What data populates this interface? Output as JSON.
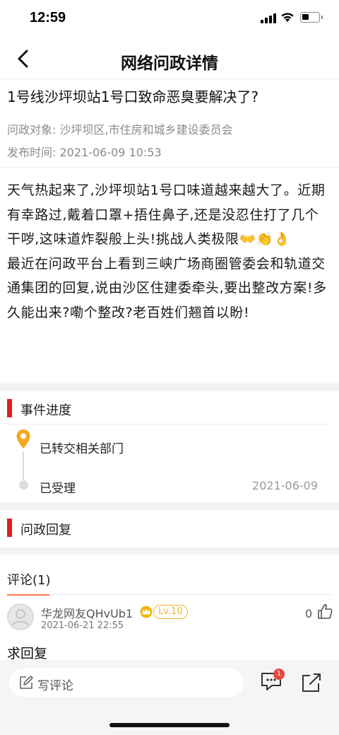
{
  "status_bar": {
    "time": "12:59"
  },
  "nav": {
    "title": "网络问政详情"
  },
  "post": {
    "title": "1号线沙坪坝站1号口致命恶臭要解决了?",
    "target_label": "问政对象:",
    "target_value": "沙坪坝区,市住房和城乡建设委员会",
    "published_label": "发布时间:",
    "published_value": "2021-06-09 10:53",
    "body_paragraph_1": "天气热起来了,沙坪坝站1号口味道越来越大了。近期有幸路过,戴着口罩+捂住鼻子,还是没忍住打了几个干哕,这味道炸裂般上头!挑战人类极限👐👏👌",
    "body_paragraph_2": "最近在问政平台上看到三峡广场商圈管委会和轨道交通集团的回复,说由沙区住建委牵头,要出整改方案!多久能出来?嘞个整改?老百姓们翘首以盼!"
  },
  "progress": {
    "section_title": "事件进度",
    "steps": [
      {
        "label": "已转交相关部门",
        "date": ""
      },
      {
        "label": "已受理",
        "date": "2021-06-09"
      }
    ]
  },
  "reply": {
    "section_title": "问政回复"
  },
  "comments": {
    "title": "评论(1)",
    "items": [
      {
        "user": "华龙网友QHvUb1",
        "level": "Lv.10",
        "date": "2021-06-21 22:55",
        "likes": "0",
        "text": "求回复"
      }
    ]
  },
  "bottom_bar": {
    "comment_placeholder": "写评论",
    "message_badge": "1"
  },
  "colors": {
    "accent_red": "#e02020",
    "pin_orange": "#f5a623",
    "tab_underline": "#ff7a45",
    "level_gold": "#f1b52b",
    "badge_red": "#e8473b"
  },
  "icons": [
    "back-arrow-icon",
    "location-pin-icon",
    "crown-icon",
    "thumb-up-icon",
    "pencil-icon",
    "chat-bubble-icon",
    "share-icon"
  ]
}
